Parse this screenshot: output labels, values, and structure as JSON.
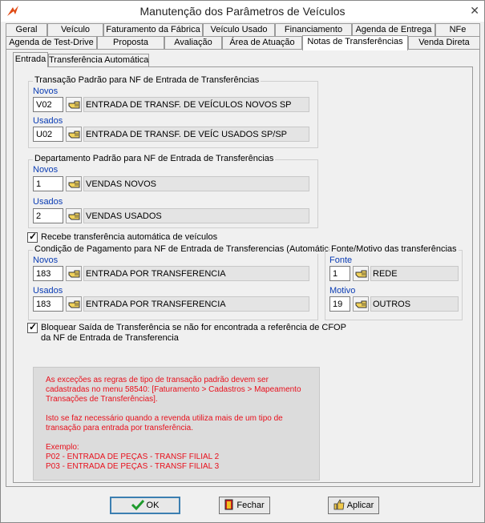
{
  "window": {
    "title": "Manutenção dos Parâmetros de Veículos",
    "close_glyph": "✕"
  },
  "tabs_row1": [
    {
      "label": "Geral"
    },
    {
      "label": "Veículo"
    },
    {
      "label": "Faturamento da Fábrica"
    },
    {
      "label": "Veículo Usado"
    },
    {
      "label": "Financiamento"
    },
    {
      "label": "Agenda de Entrega"
    },
    {
      "label": "NFe"
    }
  ],
  "tabs_row2": [
    {
      "label": "Agenda de Test-Drive"
    },
    {
      "label": "Proposta"
    },
    {
      "label": "Avaliação"
    },
    {
      "label": "Área de Atuação"
    },
    {
      "label": "Notas de Transferências",
      "active": true
    },
    {
      "label": "Venda Direta"
    }
  ],
  "subtabs": [
    {
      "label": "Entrada",
      "active": true
    },
    {
      "label": "Transferência Automática"
    }
  ],
  "transacao": {
    "title": "Transação Padrão para NF de Entrada de Transferências",
    "novos_label": "Novos",
    "novos_code": "V02",
    "novos_desc": "ENTRADA DE TRANSF. DE VEÍCULOS NOVOS SP",
    "usados_label": "Usados",
    "usados_code": "U02",
    "usados_desc": "ENTRADA DE TRANSF. DE VEÍC USADOS  SP/SP"
  },
  "departamento": {
    "title": "Departamento Padrão para NF de Entrada de Transferências",
    "novos_label": "Novos",
    "novos_code": "1",
    "novos_desc": "VENDAS NOVOS",
    "usados_label": "Usados",
    "usados_code": "2",
    "usados_desc": "VENDAS USADOS"
  },
  "recebe_checkbox": {
    "checked": true,
    "mark": "✓",
    "label": "Recebe transferência automática de veículos"
  },
  "condicao": {
    "title": "Condição de Pagamento para NF de Entrada de Transferencias (Automática)",
    "novos_label": "Novos",
    "novos_code": "183",
    "novos_desc": "ENTRADA POR TRANSFERENCIA",
    "usados_label": "Usados",
    "usados_code": "183",
    "usados_desc": "ENTRADA POR TRANSFERENCIA"
  },
  "fonte_motivo": {
    "title": "Fonte/Motivo das transferências",
    "fonte_label": "Fonte",
    "fonte_code": "1",
    "fonte_desc": "REDE",
    "motivo_label": "Motivo",
    "motivo_code": "19",
    "motivo_desc": "OUTROS"
  },
  "bloquear_checkbox": {
    "checked": true,
    "mark": "✓",
    "label_line1": "Bloquear Saída de Transferência se não for encontrada a referência de CFOP",
    "label_line2": "da NF de Entrada de Transferencia"
  },
  "notice": {
    "para1": "As exceções as regras de tipo de transação padrão devem ser cadastradas no menu 58540: [Faturamento > Cadastros > Mapeamento Transações de Transferências].",
    "para2": "Isto se faz necessário quando a revenda utiliza mais de um tipo de transação para entrada por transferência.",
    "para3_line1": "Exemplo:",
    "para3_line2": "P02 - ENTRADA DE PEÇAS - TRANSF FILIAL 2",
    "para3_line3": "P03 - ENTRADA DE PEÇAS - TRANSF FILIAL 3",
    "color": "#e8101c"
  },
  "buttons": {
    "ok": "OK",
    "fechar": "Fechar",
    "aplicar": "Aplicar"
  },
  "icons": {
    "app": "app-logo-icon",
    "lookup": "pointing-hand-icon",
    "ok": "checkmark-icon",
    "fechar": "exit-door-icon",
    "aplicar": "thumbs-up-icon"
  }
}
